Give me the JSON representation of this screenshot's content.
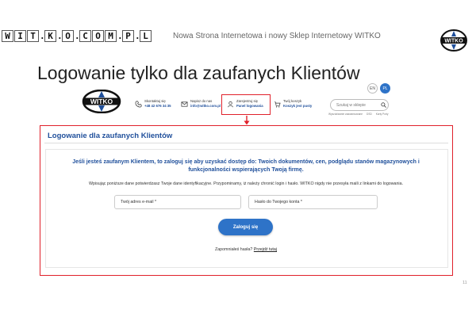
{
  "slide": {
    "title": "Nowa Strona Internetowa i nowy Sklep Internetowy WITKO",
    "heading": "Logowanie tylko dla zaufanych Klientów",
    "page_number": "11",
    "logo_tiles": [
      "W",
      "I",
      "T",
      "K",
      "O",
      "C",
      "O",
      "M",
      "P",
      "L"
    ]
  },
  "site": {
    "brand": "WITKO",
    "contact": {
      "label": "Skontaktuj się",
      "value": "+48 42 676 34 35"
    },
    "email": {
      "label": "Napisz do nas",
      "value": "info@witko.com.pl"
    },
    "account": {
      "label": "Zarejestruj się",
      "value": "Panel logowania"
    },
    "cart": {
      "label": "Twój koszyk",
      "value": "Koszyk jest pusty"
    },
    "lang_en": "EN",
    "lang_pl": "PL",
    "search_placeholder": "Szukaj w sklepie",
    "search_links": [
      "Wyszukiwanie zaawansowane",
      "DSD",
      "Karty Porty"
    ]
  },
  "login": {
    "title": "Logowanie dla zaufanych Klientów",
    "lead": "Jeśli jesteś zaufanym Klientem, to zaloguj się aby uzyskać dostęp do: Twoich dokumentów, cen, podglądu stanów magazynowych i funkcjonalności wspierających Twoją firmę.",
    "note": "Wpisując poniższe dane potwierdzasz Twoje dane identyfikacyjne. Przypominamy, iż należy chronić login i hasło. WITKO nigdy nie przesyła maili z linkami do logowania.",
    "email_placeholder": "Twój adres e-mail *",
    "password_placeholder": "Hasło do Twojego konta *",
    "button": "Zaloguj się",
    "forgot_text": "Zapomniałeś hasła?",
    "forgot_link": "Przejdź tutaj"
  },
  "colors": {
    "accent": "#e0212b",
    "brand_blue": "#1f4f9b",
    "button_blue": "#2e73c8"
  }
}
